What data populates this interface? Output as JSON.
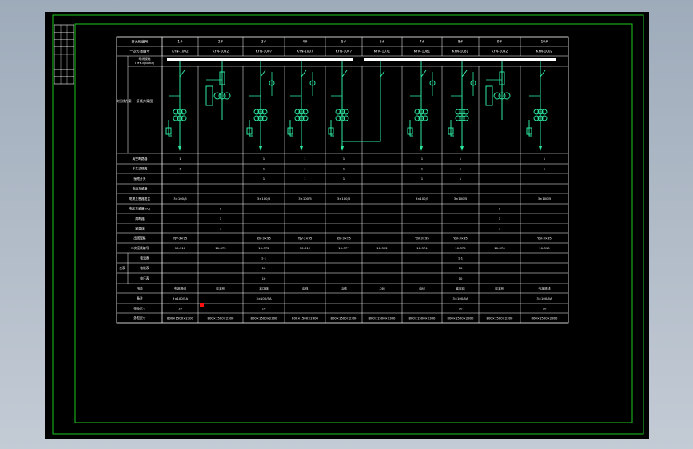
{
  "colors": {
    "background": "#b6bfcb",
    "sheet": "#000000",
    "frame": "#1ec81e",
    "table_line": "#ffffff",
    "circuit": "#2ee8a0",
    "busbar": "#ffffff",
    "marker": "#ff1010"
  },
  "title_block": {
    "cells": [
      "",
      "",
      "",
      "",
      "",
      "",
      "",
      "",
      "",
      "",
      "",
      "",
      "",
      "",
      "",
      "",
      "",
      "",
      "",
      ""
    ]
  },
  "table": {
    "header_row": [
      "开关柜编号",
      "1#",
      "2#",
      "3#",
      "4#",
      "5#",
      "6#",
      "7#",
      "8#",
      "9#",
      "10#"
    ],
    "type_row": [
      "一次方案编号",
      "KYN-1002",
      "KYN-1042",
      "KYN-1007",
      "KYN-1007",
      "KYN-1077",
      "KYN-1071",
      "KYN-1081",
      "KYN-1081",
      "KYN-1042",
      "KYN-1002"
    ],
    "busbar_label": "母线规格",
    "busbar_spec": "TMY-3(80×8)",
    "scheme_group_label": "一次接线方案",
    "scheme_label": "接线方案图",
    "rows": [
      {
        "label": "真空断路器",
        "values": [
          "1",
          "",
          "1",
          "1",
          "1",
          "",
          "1",
          "1",
          "",
          "1"
        ]
      },
      {
        "label": "手车式隔离",
        "values": [
          "1",
          "",
          "1",
          "1",
          "1",
          "",
          "1",
          "1",
          "",
          "1"
        ]
      },
      {
        "label": "接地开关",
        "values": [
          "",
          "",
          "1",
          "1",
          "1",
          "",
          "1",
          "1",
          "",
          ""
        ]
      },
      {
        "label": "电流互感器",
        "values": [
          "",
          "",
          "",
          "",
          "",
          "",
          "",
          "",
          "",
          ""
        ]
      },
      {
        "label": "电流互感器变比",
        "values": [
          "3×100/5",
          "",
          "3×100/5",
          "3×100/5",
          "3×100/5",
          "",
          "3×100/5",
          "3×100/5",
          "",
          "3×100/5"
        ]
      },
      {
        "label": "电压互感器(kV)",
        "values": [
          "",
          "1",
          "",
          "",
          "",
          "",
          "",
          "",
          "1",
          ""
        ]
      },
      {
        "label": "熔断器",
        "values": [
          "",
          "1",
          "",
          "",
          "",
          "",
          "",
          "",
          "1",
          ""
        ]
      },
      {
        "label": "避雷器",
        "values": [
          "",
          "1",
          "",
          "",
          "",
          "",
          "",
          "",
          "1",
          ""
        ]
      },
      {
        "label": "出线规格",
        "values": [
          "YJV-3×95",
          "",
          "YJV-3×95",
          "YJV-3×95",
          "YJV-3×95",
          "",
          "YJV-3×95",
          "YJV-3×95",
          "",
          "YJV-3×95"
        ]
      },
      {
        "label": "二次接线编号",
        "values": [
          "10-310",
          "10-375",
          "10-372",
          "10-312",
          "10-377",
          "10-322",
          "10-374",
          "10-375",
          "10-376",
          "10-310"
        ]
      }
    ],
    "meter_group_label": "仪表",
    "meter_rows": [
      {
        "label": "电流表",
        "values": [
          "",
          "",
          "1-1",
          "",
          "",
          "",
          "",
          "1-1",
          "",
          ""
        ]
      },
      {
        "label": "电能表",
        "values": [
          "",
          "",
          "10",
          "",
          "",
          "",
          "",
          "10",
          "",
          ""
        ]
      },
      {
        "label": "电压表",
        "values": [
          "",
          "",
          "10",
          "",
          "",
          "",
          "",
          "10",
          "",
          ""
        ]
      }
    ],
    "usage_row": {
      "label": "用途",
      "values": [
        "电源进线",
        "压变柜",
        "变压器",
        "出线",
        "出线",
        "分段",
        "出线",
        "变压器",
        "压变柜",
        "电源进线"
      ]
    },
    "remark_row": {
      "label": "备注",
      "values": [
        "3×100/5A",
        "",
        "3×100/5A",
        "",
        "",
        "",
        "",
        "3×100/5A",
        "",
        "3×100/5A"
      ]
    },
    "size_row": {
      "label": "柜体尺寸",
      "values": [
        "10",
        "",
        "10",
        "",
        "",
        "",
        "",
        "10",
        "",
        "10"
      ]
    },
    "dim_row": {
      "label": "外形尺寸",
      "values": [
        "800×1500×2300",
        "800×1500×2300",
        "800×1500×2300",
        "800×1500×2300",
        "800×1500×2300",
        "800×1500×2300",
        "800×1500×2300",
        "800×1500×2300",
        "800×1500×2300",
        "800×1500×2300"
      ]
    }
  }
}
